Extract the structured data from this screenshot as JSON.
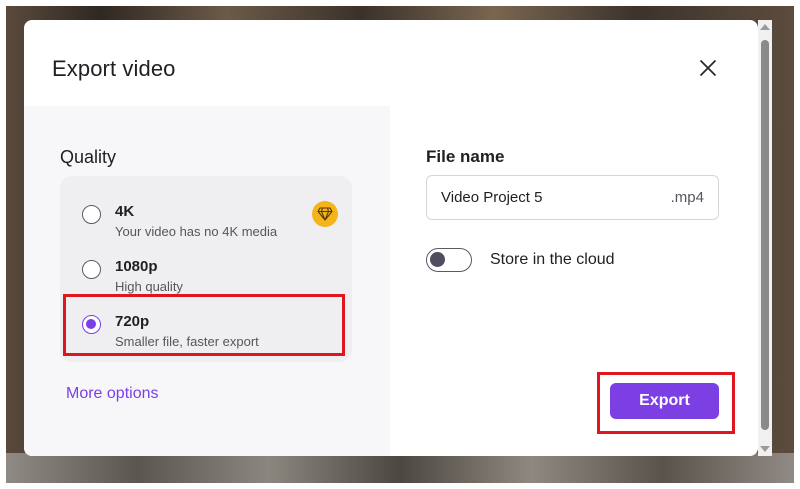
{
  "dialog": {
    "title": "Export video",
    "close_icon": "close-icon"
  },
  "quality": {
    "label": "Quality",
    "options": [
      {
        "title": "4K",
        "subtitle": "Your video has no 4K media",
        "selected": false,
        "badge_icon": "premium-diamond-icon"
      },
      {
        "title": "1080p",
        "subtitle": "High quality",
        "selected": false
      },
      {
        "title": "720p",
        "subtitle": "Smaller file, faster export",
        "selected": true
      }
    ],
    "more_options": "More options"
  },
  "file": {
    "label": "File name",
    "value": "Video Project 5",
    "extension": ".mp4"
  },
  "cloud": {
    "label": "Store in the cloud",
    "enabled": false
  },
  "actions": {
    "export_label": "Export"
  },
  "colors": {
    "accent": "#7b3fe4",
    "highlight": "#e0161e",
    "badge": "#f4b41a"
  }
}
